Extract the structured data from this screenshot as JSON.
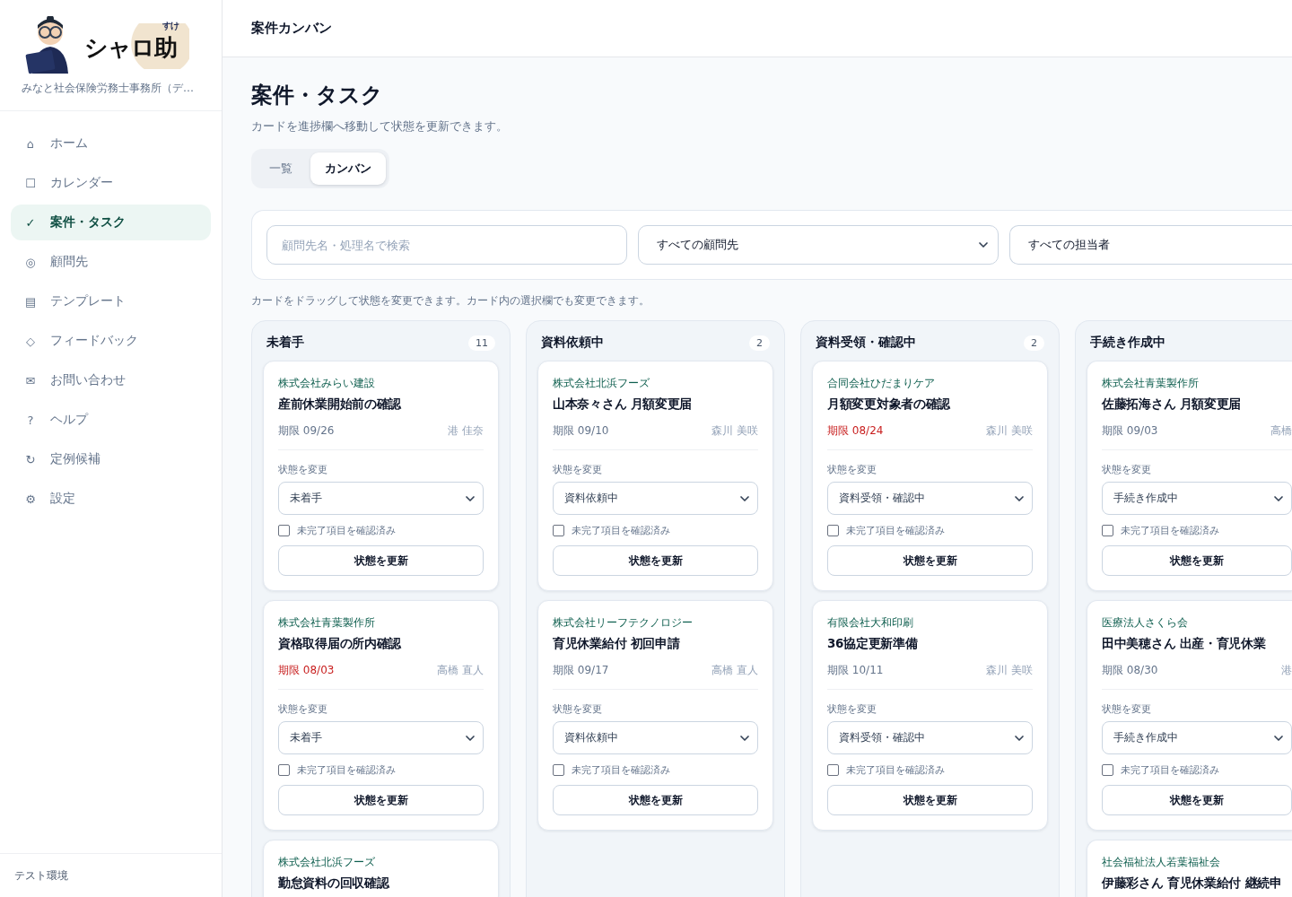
{
  "logo": {
    "name": "シャロ助",
    "ruby": "すけ"
  },
  "office": "みなと社会保険労務士事務所（デ…",
  "nav": [
    {
      "icon": "⌂",
      "label": "ホーム",
      "selected": false
    },
    {
      "icon": "☐",
      "label": "カレンダー",
      "selected": false
    },
    {
      "icon": "✓",
      "label": "案件・タスク",
      "selected": true
    },
    {
      "icon": "◎",
      "label": "顧問先",
      "selected": false
    },
    {
      "icon": "▤",
      "label": "テンプレート",
      "selected": false
    },
    {
      "icon": "◇",
      "label": "フィードバック",
      "selected": false
    },
    {
      "icon": "✉",
      "label": "お問い合わせ",
      "selected": false
    },
    {
      "icon": "?",
      "label": "ヘルプ",
      "selected": false
    },
    {
      "icon": "↻",
      "label": "定例候補",
      "selected": false
    },
    {
      "icon": "⚙",
      "label": "設定",
      "selected": false
    }
  ],
  "environment": "テスト環境",
  "topbar_title": "案件カンバン",
  "heading": "案件・タスク",
  "subtitle": "カードを進捗欄へ移動して状態を更新できます。",
  "tabs": [
    {
      "label": "一覧",
      "selected": false
    },
    {
      "label": "カンバン",
      "selected": true
    }
  ],
  "filters": {
    "search": {
      "placeholder": "顧問先名・処理名で検索"
    },
    "client_select": "すべての顧問先",
    "assignee_select": "すべての担当者"
  },
  "hint": "カードをドラッグして状態を変更できます。カード内の選択欄でも変更できます。",
  "columns": [
    {
      "title": "未着手",
      "count": "11",
      "cards": [
        {
          "client": "株式会社みらい建設",
          "title": "産前休業開始前の確認",
          "due": "期限 09/26",
          "overdue": false,
          "assignee": "港 佳奈",
          "status_label": "状態を変更",
          "status": "未着手",
          "check_label": "未完了項目を確認済み",
          "checked": false,
          "button": "状態を更新"
        },
        {
          "client": "株式会社青葉製作所",
          "title": "資格取得届の所内確認",
          "due": "期限 08/03",
          "overdue": true,
          "assignee": "高橋 直人",
          "status_label": "状態を変更",
          "status": "未着手",
          "check_label": "未完了項目を確認済み",
          "checked": false,
          "button": "状態を更新"
        },
        {
          "client": "株式会社北浜フーズ",
          "title": "勤怠資料の回収確認"
        }
      ]
    },
    {
      "title": "資料依頼中",
      "count": "2",
      "cards": [
        {
          "client": "株式会社北浜フーズ",
          "title": "山本奈々さん 月額変更届",
          "due": "期限 09/10",
          "overdue": false,
          "assignee": "森川 美咲",
          "status_label": "状態を変更",
          "status": "資料依頼中",
          "check_label": "未完了項目を確認済み",
          "checked": false,
          "button": "状態を更新"
        },
        {
          "client": "株式会社リーフテクノロジー",
          "title": "育児休業給付 初回申請",
          "due": "期限 09/17",
          "overdue": false,
          "assignee": "高橋 直人",
          "status_label": "状態を変更",
          "status": "資料依頼中",
          "check_label": "未完了項目を確認済み",
          "checked": false,
          "button": "状態を更新"
        }
      ]
    },
    {
      "title": "資料受領・確認中",
      "count": "2",
      "cards": [
        {
          "client": "合同会社ひだまりケア",
          "title": "月額変更対象者の確認",
          "due": "期限 08/24",
          "overdue": true,
          "assignee": "森川 美咲",
          "status_label": "状態を変更",
          "status": "資料受領・確認中",
          "check_label": "未完了項目を確認済み",
          "checked": false,
          "button": "状態を更新"
        },
        {
          "client": "有限会社大和印刷",
          "title": "36協定更新準備",
          "due": "期限 10/11",
          "overdue": false,
          "assignee": "森川 美咲",
          "status_label": "状態を変更",
          "status": "資料受領・確認中",
          "check_label": "未完了項目を確認済み",
          "checked": false,
          "button": "状態を更新"
        }
      ]
    },
    {
      "title": "手続き作成中",
      "cards": [
        {
          "client": "株式会社青葉製作所",
          "title": "佐藤拓海さん 月額変更届",
          "due": "期限 09/03",
          "overdue": false,
          "assignee": "高橋",
          "status_label": "状態を変更",
          "status": "手続き作成中",
          "check_label": "未完了項目を確認済み",
          "checked": false,
          "button": "状態を更新"
        },
        {
          "client": "医療法人さくら会",
          "title": "田中美穂さん 出産・育児休業",
          "due": "期限 08/30",
          "overdue": false,
          "assignee": "港",
          "status_label": "状態を変更",
          "status": "手続き作成中",
          "check_label": "未完了項目を確認済み",
          "checked": false,
          "button": "状態を更新"
        },
        {
          "client": "社会福祉法人若葉福祉会",
          "title": "伊藤彩さん 育児休業給付 継続申"
        }
      ]
    }
  ]
}
